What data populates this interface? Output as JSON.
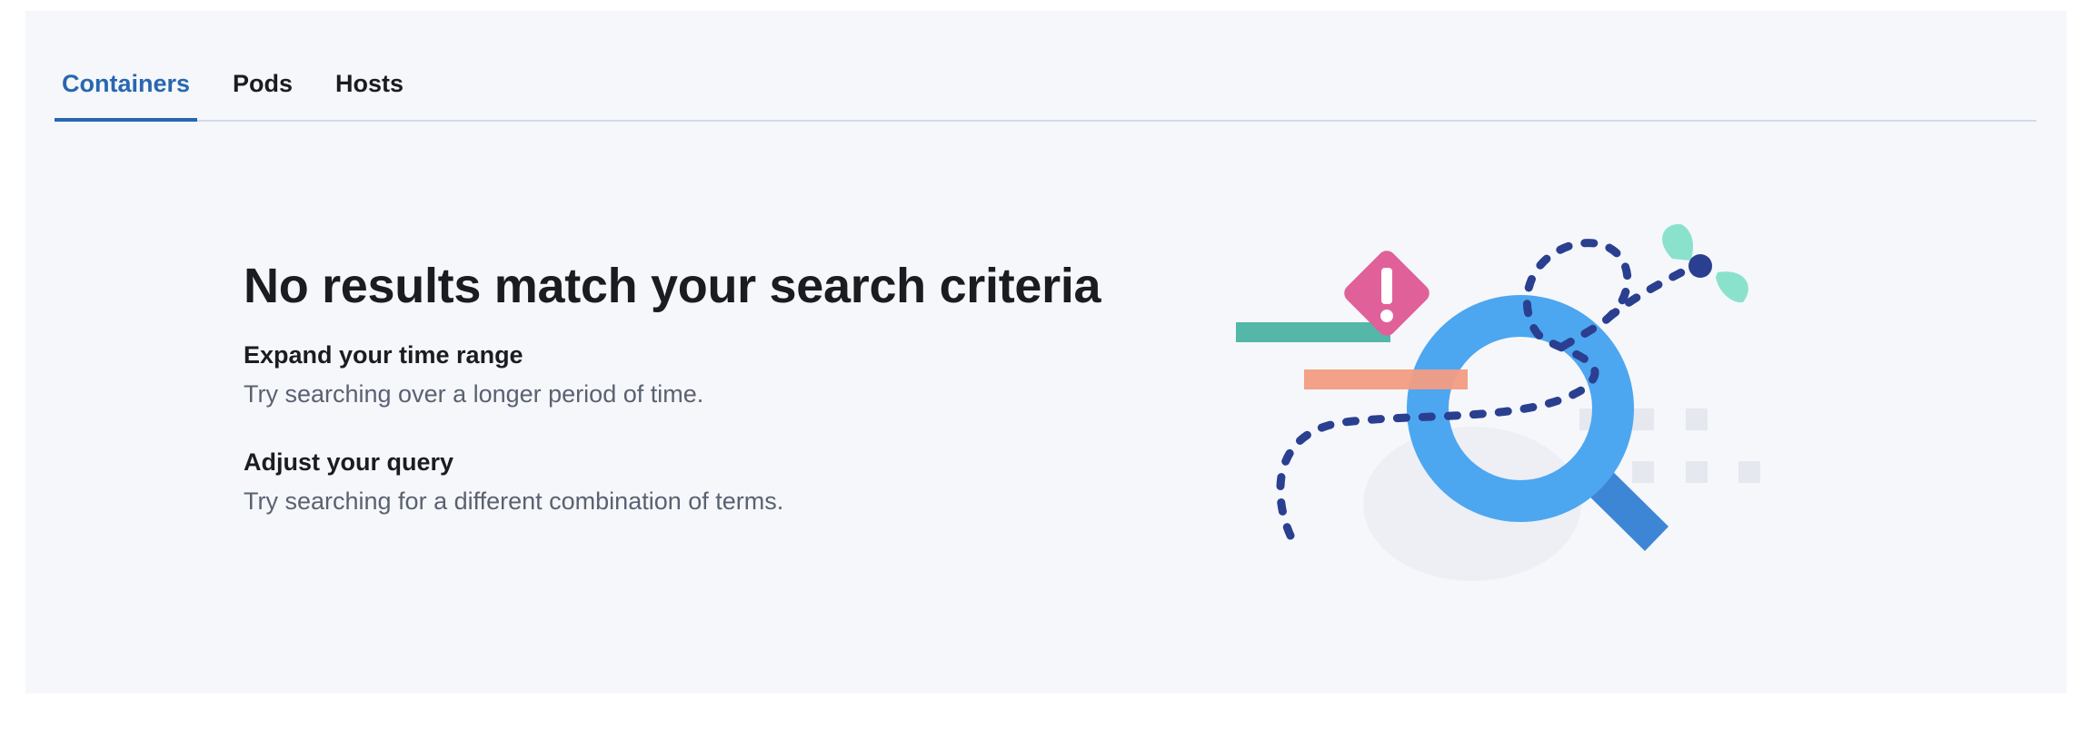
{
  "tabs": [
    {
      "label": "Containers",
      "active": true
    },
    {
      "label": "Pods",
      "active": false
    },
    {
      "label": "Hosts",
      "active": false
    }
  ],
  "empty_state": {
    "title": "No results match your search criteria",
    "suggestions": [
      {
        "title": "Expand your time range",
        "description": "Try searching over a longer period of time."
      },
      {
        "title": "Adjust your query",
        "description": "Try searching for a different combination of terms."
      }
    ]
  },
  "colors": {
    "accent": "#2867b0",
    "background": "#f5f7fb",
    "magnifier": "#4da6f0",
    "warning": "#e0619a",
    "teal_bar": "#54b7a8",
    "salmon_bar": "#f29c82",
    "dashed_path": "#2a3f8f"
  },
  "illustration": {
    "icon": "magnifying-glass-no-results-icon",
    "warning_icon": "warning-diamond-icon"
  }
}
